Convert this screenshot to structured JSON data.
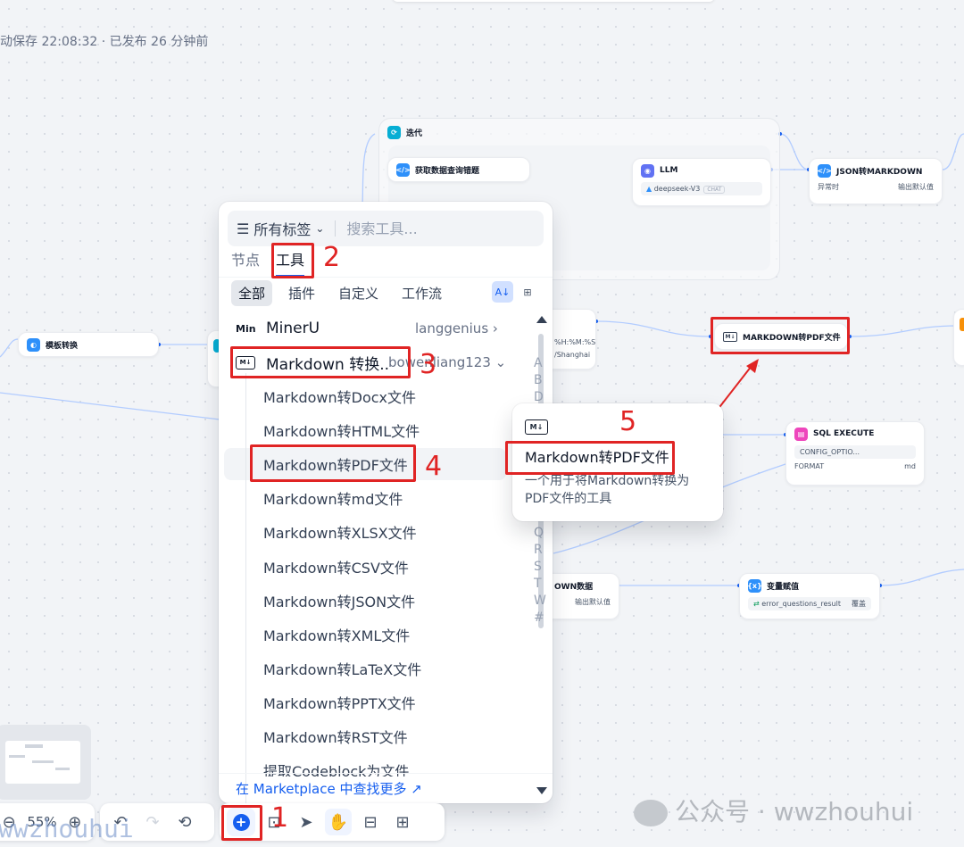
{
  "status_text": "动保存 22:08:32 · 已发布 26 分钟前",
  "canvas": {
    "iteration": {
      "title": "迭代"
    },
    "fetch_node": {
      "title": "获取数据查询错题"
    },
    "llm_node": {
      "title": "LLM",
      "model": "deepseek-V3",
      "tag": "CHAT"
    },
    "json_node": {
      "title": "JSON转MARKDOWN",
      "left": "异常时",
      "right": "输出默认值"
    },
    "template_node": {
      "title": "模板转换"
    },
    "partial_node": {
      "line1": "%H:%M:%S",
      "line2": "/Shanghai"
    },
    "pdf_node": {
      "title": "MARKDOWN转PDF文件"
    },
    "sql_node": {
      "title": "SQL EXECUTE",
      "row1_key": "CONFIG_OPTIO...",
      "row2_key": "FORMAT",
      "row2_val": "md"
    },
    "own_node": {
      "title": "OWN数据",
      "right": "输出默认值"
    },
    "var_node": {
      "title": "变量赋值",
      "var": "error_questions_result",
      "action": "覆盖"
    }
  },
  "panel": {
    "filter_label": "所有标签",
    "search_placeholder": "搜索工具...",
    "tabs": [
      {
        "label": "节点",
        "active": false
      },
      {
        "label": "工具",
        "active": true
      }
    ],
    "categories": [
      {
        "label": "全部",
        "active": true
      },
      {
        "label": "插件",
        "active": false
      },
      {
        "label": "自定义",
        "active": false
      },
      {
        "label": "工作流",
        "active": false
      }
    ],
    "providers": [
      {
        "logo": "Min",
        "name": "MinerU",
        "author": "langgenius",
        "chevron": "›"
      },
      {
        "logo": "M↓",
        "name": "Markdown 转换...",
        "author": "bowenliang123",
        "chevron": "⌄"
      }
    ],
    "tools": [
      "Markdown转Docx文件",
      "Markdown转HTML文件",
      "Markdown转PDF文件",
      "Markdown转md文件",
      "Markdown转XLSX文件",
      "Markdown转CSV文件",
      "Markdown转JSON文件",
      "Markdown转XML文件",
      "Markdown转LaTeX文件",
      "Markdown转PPTX文件",
      "Markdown转RST文件",
      "提取Codeblock为文件"
    ],
    "alphabet": [
      "A",
      "B",
      "D",
      "",
      "",
      "",
      "",
      "",
      "",
      "",
      "Q",
      "R",
      "S",
      "T",
      "W",
      "#"
    ],
    "footer_link": "在 Marketplace 中查找更多 ↗"
  },
  "tooltip": {
    "logo": "M↓",
    "title": "Markdown转PDF文件",
    "description": "一个用于将Markdown转换为PDF文件的工具"
  },
  "annotations": [
    "1",
    "2",
    "3",
    "4",
    "5"
  ],
  "toolbar": {
    "zoom": "55%"
  },
  "watermarks": {
    "left": "wwzhouhui",
    "right": "公众号 · wwzhouhui"
  },
  "colors": {
    "accent": "#155eef",
    "annotation_red": "#e02424"
  }
}
